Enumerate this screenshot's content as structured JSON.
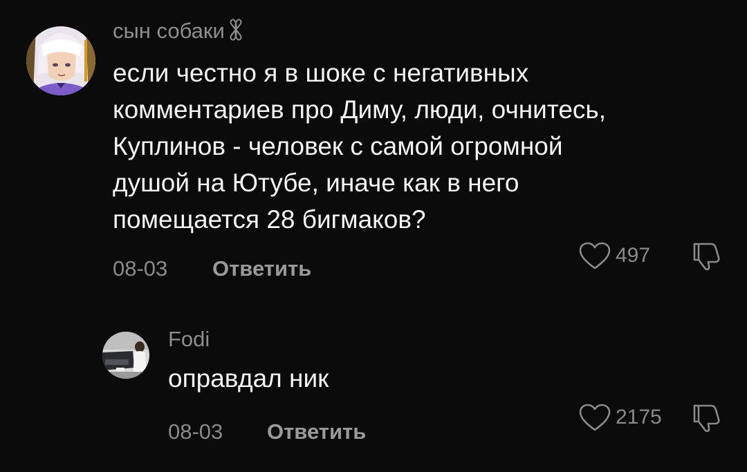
{
  "comments": [
    {
      "username": "сын собаки",
      "username_badge_icon": "sparkle-infinity-icon",
      "avatar_icon": "anime-avatar-icon",
      "text_lines": [
        "если честно я в шоке с негативных",
        "комментариев про Диму, люди, очнитесь,",
        "Куплинов - человек с самой огромной",
        "душой на Ютубе, иначе как в него",
        "помещается 28 бигмаков?"
      ],
      "date": "08-03",
      "reply_label": "Ответить",
      "like_icon": "heart-icon",
      "likes": "497",
      "dislike_icon": "thumbs-down-icon"
    },
    {
      "username": "Fodi",
      "avatar_icon": "photo-avatar-icon",
      "text_lines": [
        "оправдал ник"
      ],
      "date": "08-03",
      "reply_label": "Ответить",
      "like_icon": "heart-icon",
      "likes": "2175",
      "dislike_icon": "thumbs-down-icon"
    }
  ],
  "colors": {
    "background": "#0b0b0b",
    "text": "#f4f4f4",
    "muted": "#8a8a8a"
  }
}
